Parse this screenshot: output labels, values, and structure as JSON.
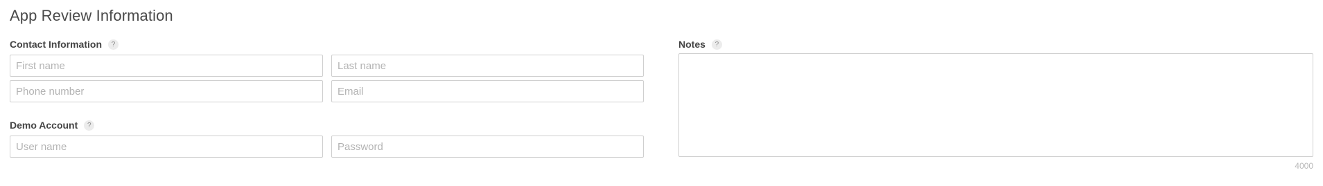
{
  "page": {
    "title": "App Review Information"
  },
  "contact": {
    "label": "Contact Information",
    "help": "?",
    "first_name_placeholder": "First name",
    "last_name_placeholder": "Last name",
    "phone_placeholder": "Phone number",
    "email_placeholder": "Email"
  },
  "demo": {
    "label": "Demo Account",
    "help": "?",
    "username_placeholder": "User name",
    "password_placeholder": "Password"
  },
  "notes": {
    "label": "Notes",
    "help": "?",
    "value": "",
    "char_limit": "4000"
  }
}
